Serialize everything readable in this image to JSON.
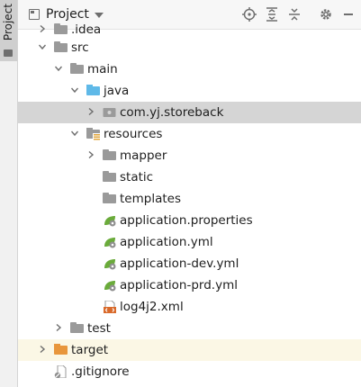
{
  "side": {
    "tab_label": "Project"
  },
  "toolbar": {
    "title": "Project",
    "icons": [
      "locate-icon",
      "expand-all-icon",
      "collapse-all-icon",
      "settings-icon",
      "hide-icon"
    ]
  },
  "colors": {
    "selection": "#d5d5d5",
    "excluded_highlight": "#fbf7e5",
    "source_folder": "#5fb9e8",
    "excluded_folder": "#e8963c",
    "spring_green": "#6aab3a",
    "xml_orange": "#d96a2b"
  },
  "tree": [
    {
      "label": ".idea",
      "icon": "folder-icon"
    },
    {
      "label": "src",
      "icon": "folder-icon"
    },
    {
      "label": "main",
      "icon": "folder-icon"
    },
    {
      "label": "java",
      "icon": "source-folder-icon"
    },
    {
      "label": "com.yj.storeback",
      "icon": "package-icon"
    },
    {
      "label": "resources",
      "icon": "resources-folder-icon"
    },
    {
      "label": "mapper",
      "icon": "folder-icon"
    },
    {
      "label": "static",
      "icon": "folder-icon"
    },
    {
      "label": "templates",
      "icon": "folder-icon"
    },
    {
      "label": "application.properties",
      "icon": "spring-config-icon"
    },
    {
      "label": "application.yml",
      "icon": "spring-config-icon"
    },
    {
      "label": "application-dev.yml",
      "icon": "spring-config-icon"
    },
    {
      "label": "application-prd.yml",
      "icon": "spring-config-icon"
    },
    {
      "label": "log4j2.xml",
      "icon": "xml-file-icon"
    },
    {
      "label": "test",
      "icon": "folder-icon"
    },
    {
      "label": "target",
      "icon": "excluded-folder-icon"
    },
    {
      "label": ".gitignore",
      "icon": "gitignore-icon"
    }
  ]
}
